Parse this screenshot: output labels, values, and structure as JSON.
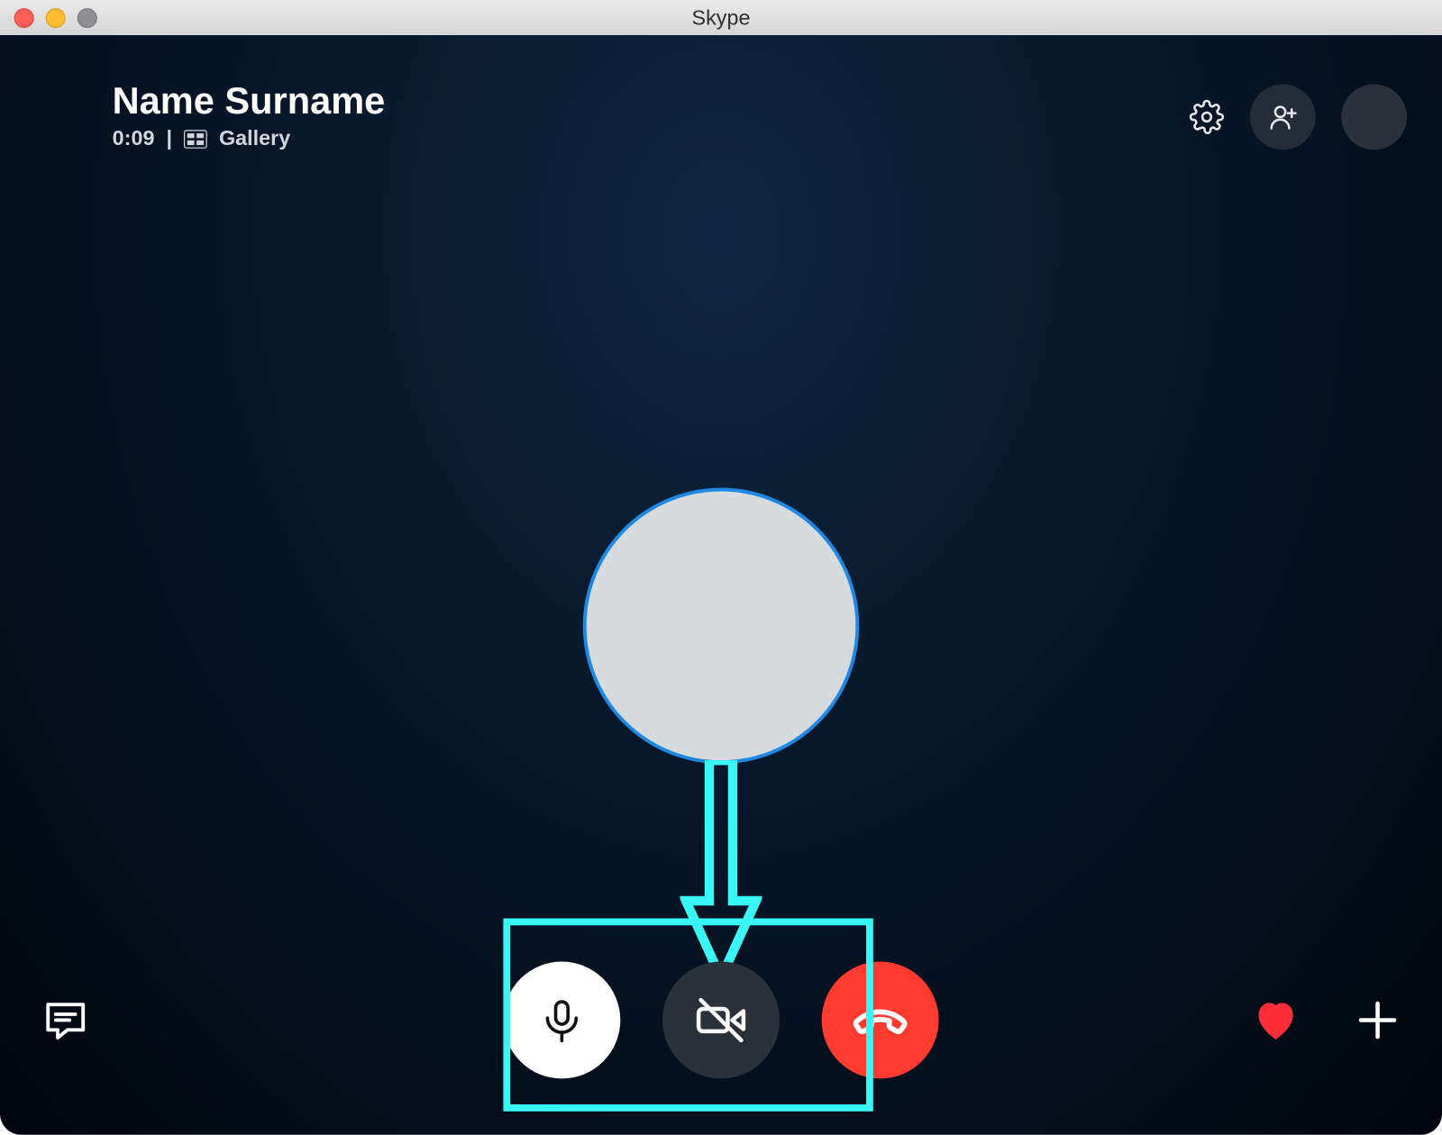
{
  "window": {
    "title": "Skype"
  },
  "header": {
    "contact_name": "Name Surname",
    "call_time": "0:09",
    "separator": "|",
    "view_label": "Gallery"
  },
  "colors": {
    "annotation": "#39f7f7",
    "hangup": "#ff3b30",
    "heart": "#ff2d3a",
    "avatar_ring": "#1e88e5"
  }
}
